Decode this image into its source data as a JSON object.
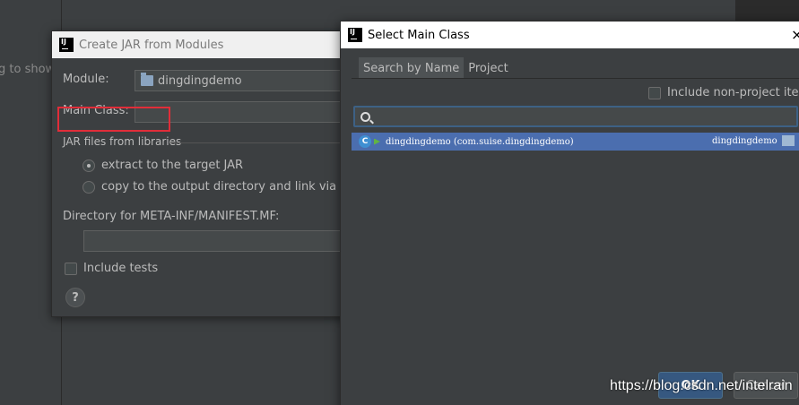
{
  "background": {
    "hint_text": "g to show"
  },
  "jar_dialog": {
    "title": "Create JAR from Modules",
    "module_label": "Module:",
    "module_value": "dingdingdemo",
    "main_class_label": "Main Class:",
    "main_class_value": "",
    "jar_files_section": "JAR files from libraries",
    "option_extract": "extract to the target JAR",
    "option_copy": "copy to the output directory and link via mani",
    "directory_label": "Directory for META-INF/MANIFEST.MF:",
    "directory_value": "",
    "include_tests_label": "Include tests",
    "help_label": "?"
  },
  "main_class_dialog": {
    "title": "Select Main Class",
    "close_label": "×",
    "tabs": [
      "Search by Name",
      "Project"
    ],
    "include_nonproject_label": "Include non-project items",
    "search_value": "",
    "results": [
      {
        "class_name": "dingdingdemo",
        "package": "(com.suise.dingdingdemo)",
        "module": "dingdingdemo"
      }
    ],
    "ok_label": "OK",
    "cancel_label": "Cancel"
  },
  "watermark": "https://blog.csdn.net/intelrain",
  "colors": {
    "selection": "#4b6eaf",
    "highlight_box": "#e12d39",
    "background": "#3c3f41"
  }
}
